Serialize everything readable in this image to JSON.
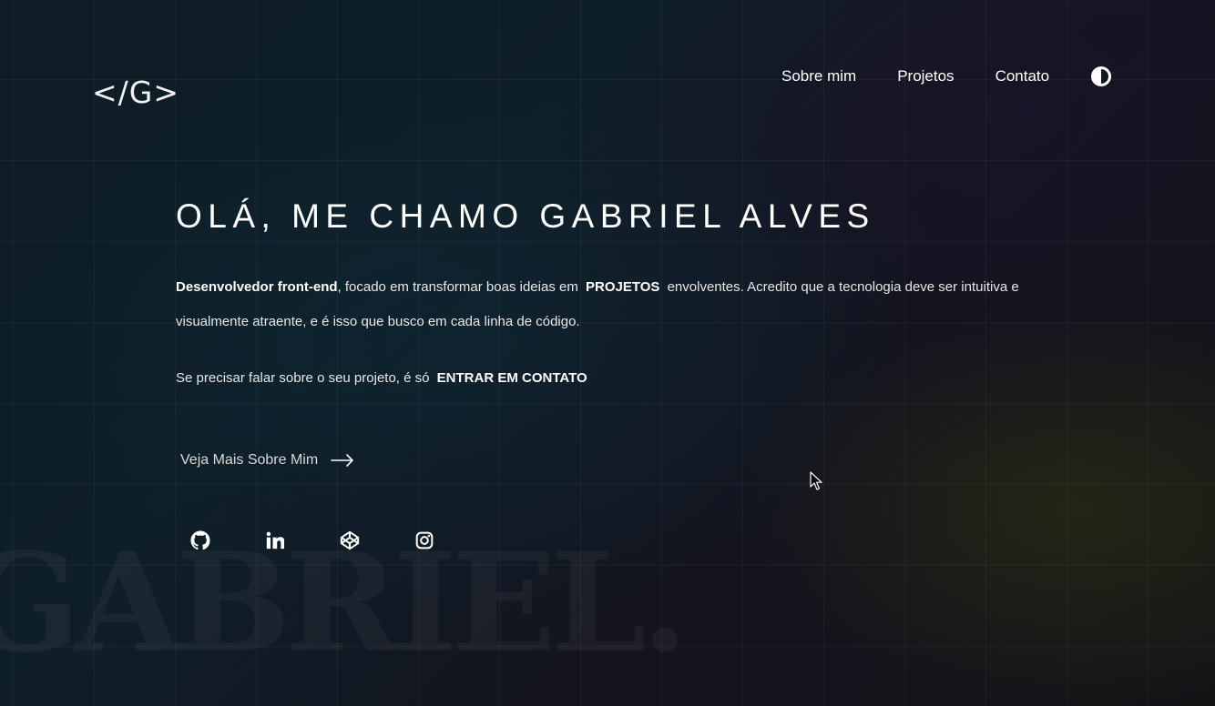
{
  "logo": "</G>",
  "nav": {
    "about": "Sobre mim",
    "projects": "Projetos",
    "contact": "Contato"
  },
  "hero": {
    "title": "OLÁ, ME CHAMO GABRIEL ALVES",
    "role_bold": "Desenvolvedor front-end",
    "text_1": ", focado em transformar boas ideias em",
    "projects_link": "PROJETOS",
    "text_2": "envolventes. Acredito que a tecnologia deve ser intuitiva e visualmente atraente, e é isso que busco em cada linha de código.",
    "contact_text": "Se precisar falar sobre o seu projeto, é só",
    "contact_link": "ENTRAR EM CONTATO",
    "more_link": "Veja Mais Sobre Mim"
  },
  "background_word": "GABRIEL.",
  "socials": [
    {
      "icon": "github-icon"
    },
    {
      "icon": "linkedin-icon"
    },
    {
      "icon": "codepen-icon"
    },
    {
      "icon": "instagram-icon"
    }
  ],
  "colors": {
    "text": "#ffffff",
    "background": "#0f1f29"
  }
}
